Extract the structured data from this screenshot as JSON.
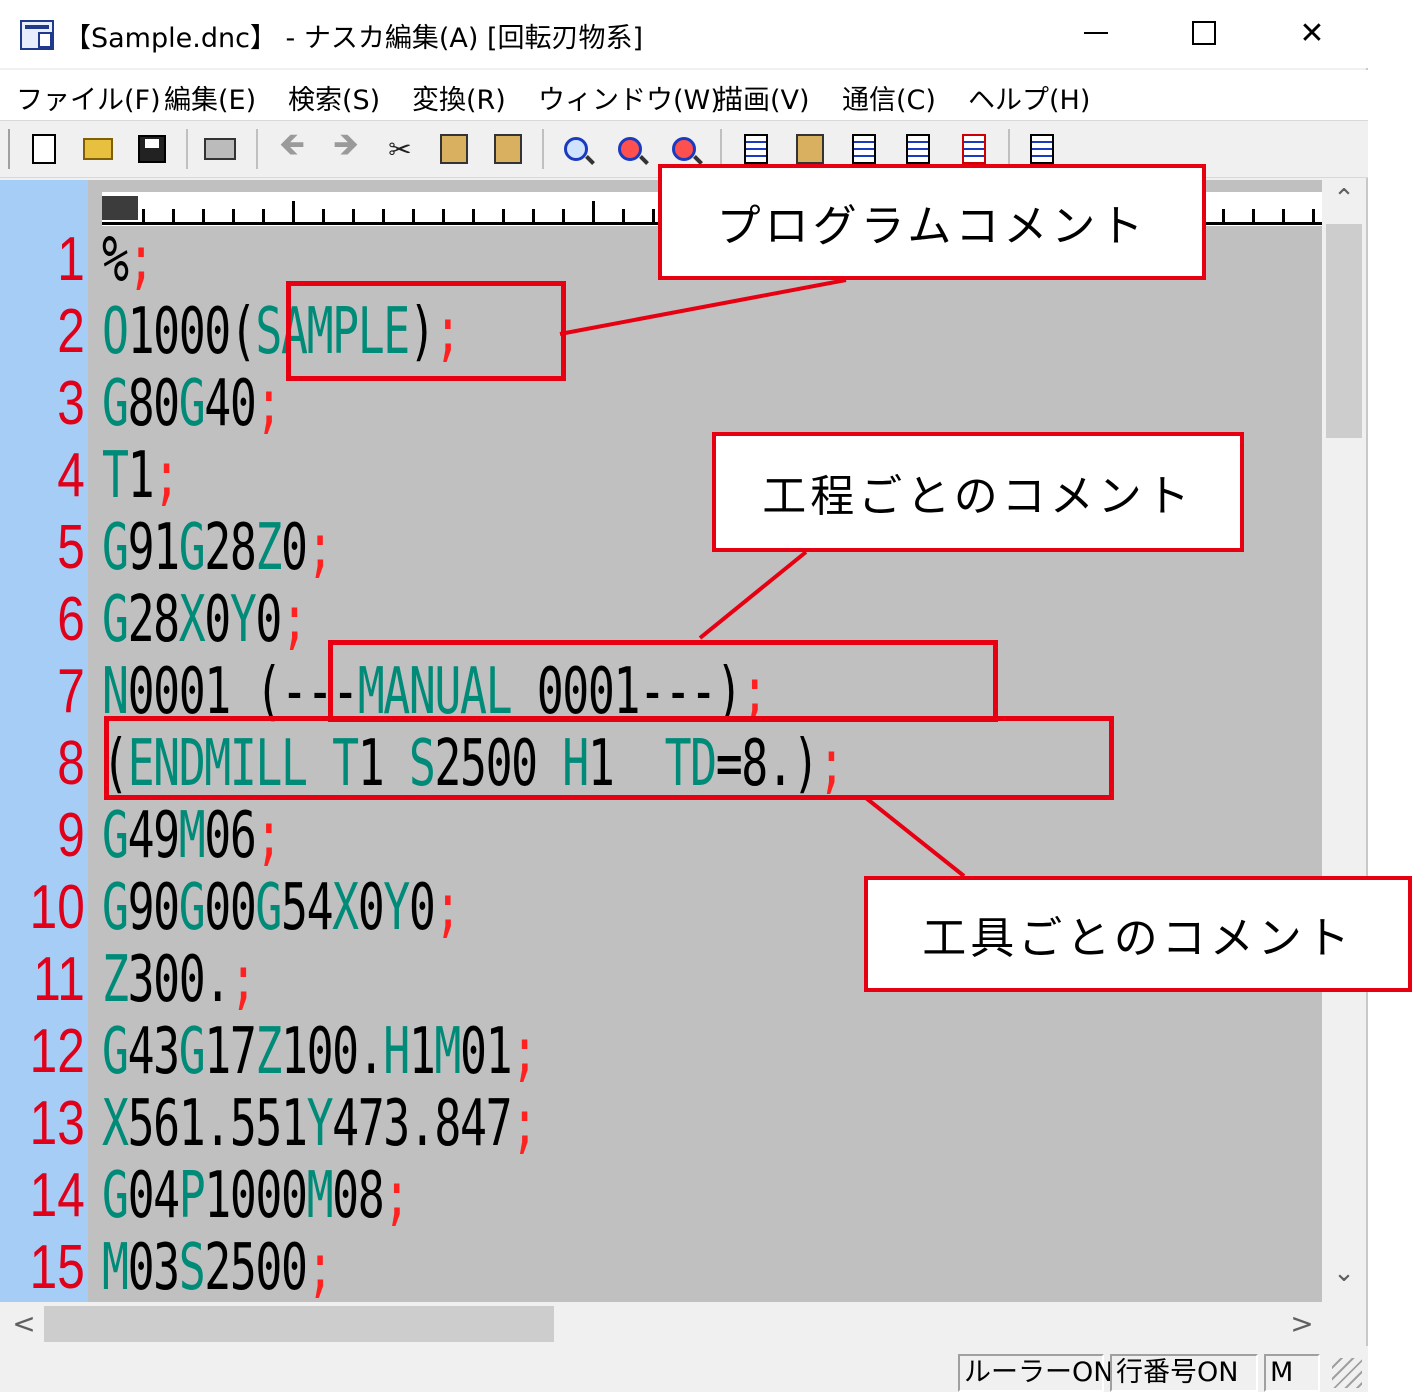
{
  "window": {
    "title": "【Sample.dnc】 - ナスカ編集(A) [回転刃物系]",
    "minimize_symbol": "",
    "close_symbol": "✕"
  },
  "menu": [
    "ファイル(F)",
    "編集(E)",
    "検索(S)",
    "変換(R)",
    "ウィンドウ(W)",
    "描画(V)",
    "通信(C)",
    "ヘルプ(H)"
  ],
  "toolbar": {
    "back_arrow": "🡸",
    "forward_arrow": "🡺",
    "cut_glyph": "✂",
    "icons": [
      "new-file-icon",
      "open-folder-icon",
      "save-icon",
      "print-icon",
      "back-arrow-icon",
      "forward-arrow-icon",
      "cut-icon",
      "copy-icon",
      "paste-icon",
      "search-icon",
      "search-next-icon",
      "search-prev-icon",
      "page-icon",
      "clipboard-icon",
      "copy-page-icon",
      "list-icon",
      "delete-page-icon",
      "edit-icon"
    ]
  },
  "code": [
    {
      "n": "1",
      "text": "%;"
    },
    {
      "n": "2",
      "text": "O1000(SAMPLE);"
    },
    {
      "n": "3",
      "text": "G80G40;"
    },
    {
      "n": "4",
      "text": "T1;"
    },
    {
      "n": "5",
      "text": "G91G28Z0;"
    },
    {
      "n": "6",
      "text": "G28X0Y0;"
    },
    {
      "n": "7",
      "text": "N0001 (---MANUAL 0001---);"
    },
    {
      "n": "8",
      "text": "(ENDMILL T1 S2500 H1  TD=8.);"
    },
    {
      "n": "9",
      "text": "G49M06;"
    },
    {
      "n": "10",
      "text": "G90G00G54X0Y0;"
    },
    {
      "n": "11",
      "text": "Z300.;"
    },
    {
      "n": "12",
      "text": "G43G17Z100.H1M01;"
    },
    {
      "n": "13",
      "text": "X561.551Y473.847;"
    },
    {
      "n": "14",
      "text": "G04P1000M08;"
    },
    {
      "n": "15",
      "text": "M03S2500;"
    }
  ],
  "scroll": {
    "up": "⌃",
    "down": "⌄",
    "left": "<",
    "right": ">"
  },
  "status": {
    "ruler": "ルーラーON",
    "line_numbers": "行番号ON",
    "mode": "M"
  },
  "annotations": {
    "program_comment": "プログラムコメント",
    "process_comment": "工程ごとのコメント",
    "tool_comment": "工具ごとのコメント"
  },
  "colors": {
    "line_number": "#e0001a",
    "gutter": "#a6cdf5",
    "editor_bg": "#c0c0c0",
    "code_letter": "#008a78",
    "semicolon": "#ff2020",
    "annotation": "#e60012"
  }
}
